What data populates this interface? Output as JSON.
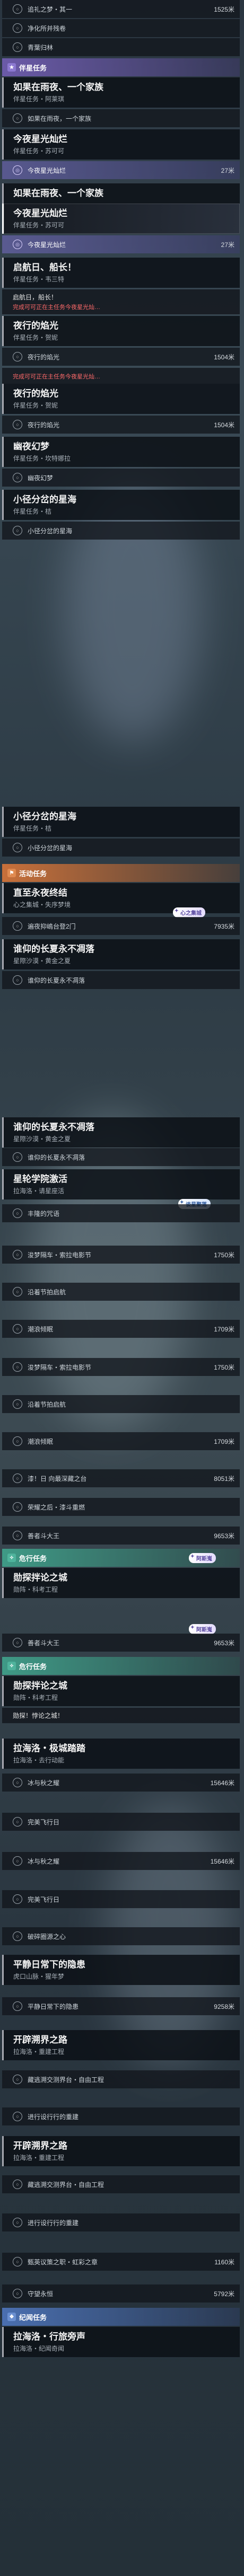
{
  "accent": {
    "purple": "#6b5aa8",
    "orange": "#c8703a",
    "green": "#3f9a86",
    "blue": "#4a6fb0",
    "warning": "#ff6a6a"
  },
  "top_rows": [
    {
      "label": "追礼之梦・其一",
      "distance": "1525米"
    },
    {
      "label": "净化所并残卷",
      "distance": ""
    },
    {
      "label": "青葉归林",
      "distance": ""
    }
  ],
  "sections": {
    "companion": {
      "label": "伴星任务",
      "icon": "star-icon"
    },
    "activity": {
      "label": "活动任务",
      "icon": "flag-icon"
    },
    "adventure": {
      "label": "危行任务",
      "icon": "compass-icon"
    },
    "adventure2": {
      "label": "危行任务",
      "icon": "compass-icon"
    },
    "chronicle": {
      "label": "纪闻任务",
      "icon": "book-icon"
    }
  },
  "cards": {
    "c1": {
      "title": "如果在雨夜、一个家族",
      "sub": "伴星任务・阿莱琪"
    },
    "c1s": {
      "label": "如果在雨夜，一个家族"
    },
    "c2": {
      "title": "今夜星光灿烂",
      "sub": "伴星任务・苏可可"
    },
    "c2s": {
      "label": "今夜星光灿烂",
      "distance": "27米"
    },
    "c3": {
      "title": "如果在雨夜、一个家族",
      "sub": ""
    },
    "c4": {
      "title": "今夜星光灿烂",
      "sub": "伴星任务・苏可可"
    },
    "c4s": {
      "label": "今夜星光灿烂",
      "distance": "27米"
    },
    "c5": {
      "title": "启航日、船长！",
      "sub": "伴星任务・韦三特"
    },
    "c5w": {
      "a": "启航日，船长！",
      "b": "完成可可正在主任务今夜星光灿…"
    },
    "c6": {
      "title": "夜行的焰光",
      "sub": "伴星任务・贺妮"
    },
    "c6s": {
      "label": "夜行的焰光",
      "distance": "1504米"
    },
    "c6w": {
      "b": "完成可可正在主任务今夜星光灿…"
    },
    "c7": {
      "title": "夜行的焰光",
      "sub": "伴星任务・贺妮"
    },
    "c7s": {
      "label": "夜行的焰光",
      "distance": "1504米"
    },
    "c8": {
      "title": "幽夜幻梦",
      "sub": "伴星任务・坎特娜拉"
    },
    "c8s": {
      "label": "幽夜幻梦"
    },
    "c9": {
      "title": "小径分岔的星海",
      "sub": "伴星任务・桔"
    },
    "c9s": {
      "label": "小径分岔的星海"
    },
    "c10": {
      "title": "小径分岔的星海",
      "sub": "伴星任务・桔"
    },
    "c10s": {
      "label": "小径分岔的星海"
    },
    "a1": {
      "title": "直至永夜终结",
      "sub": "心之集城・失序梦境"
    },
    "a1s": {
      "label": "遍夜抑嶋台登2门",
      "distance": "7935米"
    },
    "a1tag": "心之集城",
    "a2": {
      "title": "谁仰的长夏永不凋落",
      "sub": "星際沙漠・黄金之夏"
    },
    "a2s": {
      "label": "谁仰的长夏永不凋落"
    },
    "a3": {
      "title": "谁仰的长夏永不凋落",
      "sub": "星際沙漠・黄金之夏"
    },
    "a3s": {
      "label": "谁仰的长夏永不凋落"
    },
    "a4": {
      "title": "星轮学院激活",
      "sub": "拉海洛・请星座活"
    },
    "a4tags": "谈星聚落",
    "a4r": [
      {
        "label": "丰隆的咒语",
        "distance": ""
      },
      {
        "label": "浚梦隔车・索拉电影节",
        "distance": "1750米"
      },
      {
        "label": "沿着节拍启航",
        "distance": ""
      },
      {
        "label": "潮浪倾眠",
        "distance": "1709米"
      }
    ],
    "a5r": [
      {
        "label": "浚梦隔车・索拉电影节",
        "distance": "1750米"
      },
      {
        "label": "沿着节拍启航",
        "distance": ""
      },
      {
        "label": "潮浪倾眠",
        "distance": "1709米"
      },
      {
        "label": "漆！日 向最深藏之台",
        "distance": "8051米"
      },
      {
        "label": "荣耀之后・漆斗重燃",
        "distance": ""
      },
      {
        "label": "善者斗大王",
        "distance": "9653米"
      }
    ],
    "a5tag": "阿斯嵬",
    "d1": {
      "title": "勋探拌论之城",
      "sub": "勋阵・科考工程"
    },
    "d1s": {
      "label": "善者斗大王",
      "distance": "9653米"
    },
    "d1tag": "阿斯嵬",
    "d2": {
      "title": "勋探拌论之城",
      "sub": "勋阵・科考工程"
    },
    "d2w": {
      "a": "勋探！悖论之城！"
    },
    "d3": {
      "title": "拉海洛・极城踏踏",
      "sub": "拉海洛・去行动能"
    },
    "d3r": [
      {
        "label": "冰与秋之耀",
        "distance": "15646米"
      },
      {
        "label": "完美飞行日",
        "distance": ""
      },
      {
        "label": "冰与秋之耀",
        "distance": "15646米"
      },
      {
        "label": "完美飞行日",
        "distance": ""
      },
      {
        "label": "破碎圈源之心",
        "distance": ""
      }
    ],
    "d4": {
      "title": "平静日常下的隐患",
      "sub": "虎口山脉・猩年梦"
    },
    "d4s": {
      "label": "平静日常下的隐患",
      "distance": "9258米"
    },
    "d5": {
      "title": "开辟溯界之路",
      "sub": "拉海洛・重建工程"
    },
    "d5r": [
      {
        "label": "藏逃溯交测界台・自由工程"
      },
      {
        "label": "进行设行行的重建"
      }
    ],
    "d6": {
      "title": "开辟溯界之路",
      "sub": "拉海洛・重建工程"
    },
    "d6r": [
      {
        "label": "藏逃溯交测界台・自由工程",
        "distance": ""
      },
      {
        "label": "进行设行行的重建",
        "distance": ""
      },
      {
        "label": "甄英议策之职・虹彩之章",
        "distance": "1160米"
      },
      {
        "label": "守望永恒",
        "distance": "5792米"
      }
    ],
    "e1": {
      "title": "拉海洛・行旅旁声",
      "sub": "拉海洛・纪闻奇闻"
    }
  }
}
